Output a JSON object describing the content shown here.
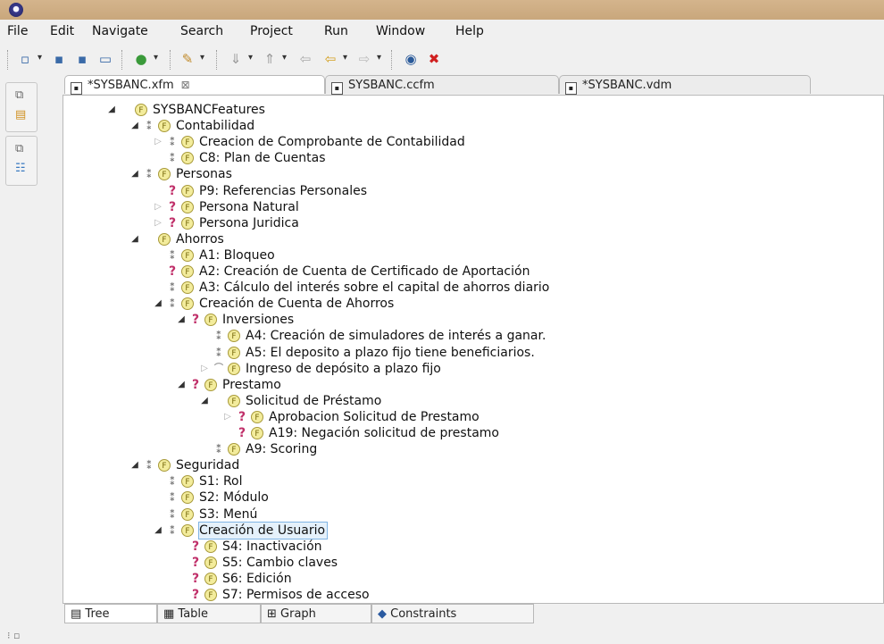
{
  "menubar": [
    "File",
    "Edit",
    "Navigate",
    "Search",
    "Project",
    "Run",
    "Window",
    "Help"
  ],
  "editor_tabs": [
    {
      "label": "*SYSBANC.xfm",
      "active": true,
      "close": "⊠"
    },
    {
      "label": "SYSBANC.ccfm",
      "active": false
    },
    {
      "label": "*SYSBANC.vdm",
      "active": false
    }
  ],
  "feature_badge": "F",
  "tree": [
    {
      "label": "SYSBANCFeatures",
      "toggle": "expanded",
      "constraint": "none"
    },
    {
      "label": "Contabilidad",
      "toggle": "expanded",
      "constraint": "mandatory"
    },
    {
      "label": "Creacion de Comprobante de Contabilidad",
      "toggle": "collapsed",
      "constraint": "mandatory"
    },
    {
      "label": "C8: Plan de Cuentas",
      "toggle": "none",
      "constraint": "mandatory"
    },
    {
      "label": "Personas",
      "toggle": "expanded",
      "constraint": "mandatory"
    },
    {
      "label": "P9: Referencias Personales",
      "toggle": "none",
      "constraint": "optional"
    },
    {
      "label": "Persona Natural",
      "toggle": "collapsed",
      "constraint": "optional"
    },
    {
      "label": "Persona Juridica",
      "toggle": "collapsed",
      "constraint": "optional"
    },
    {
      "label": "Ahorros",
      "toggle": "expanded",
      "constraint": "none"
    },
    {
      "label": "A1: Bloqueo",
      "toggle": "none",
      "constraint": "mandatory"
    },
    {
      "label": "A2:  Creación de Cuenta de Certificado de Aportación",
      "toggle": "none",
      "constraint": "optional"
    },
    {
      "label": "A3: Cálculo del interés sobre el capital de ahorros diario",
      "toggle": "none",
      "constraint": "mandatory"
    },
    {
      "label": "Creación de Cuenta de Ahorros",
      "toggle": "expanded",
      "constraint": "mandatory"
    },
    {
      "label": "Inversiones",
      "toggle": "expanded",
      "constraint": "optional"
    },
    {
      "label": "A4: Creación de simuladores de interés a ganar.",
      "toggle": "none",
      "constraint": "mandatory"
    },
    {
      "label": "A5: El deposito a plazo fijo tiene beneficiarios.",
      "toggle": "none",
      "constraint": "mandatory"
    },
    {
      "label": "Ingreso de depósito a plazo fijo",
      "toggle": "collapsed",
      "constraint": "alternative"
    },
    {
      "label": "Prestamo",
      "toggle": "expanded",
      "constraint": "optional"
    },
    {
      "label": "Solicitud de Préstamo",
      "toggle": "expanded",
      "constraint": "none"
    },
    {
      "label": "Aprobacion Solicitud de Prestamo",
      "toggle": "collapsed",
      "constraint": "optional"
    },
    {
      "label": "A19: Negación solicitud  de prestamo",
      "toggle": "none",
      "constraint": "optional"
    },
    {
      "label": "A9: Scoring",
      "toggle": "none",
      "constraint": "mandatory"
    },
    {
      "label": "Seguridad",
      "toggle": "expanded",
      "constraint": "mandatory"
    },
    {
      "label": "S1: Rol",
      "toggle": "none",
      "constraint": "mandatory"
    },
    {
      "label": "S2: Módulo",
      "toggle": "none",
      "constraint": "mandatory"
    },
    {
      "label": "S3: Menú",
      "toggle": "none",
      "constraint": "mandatory"
    },
    {
      "label": "Creación de Usuario",
      "toggle": "expanded",
      "constraint": "mandatory",
      "selected": true
    },
    {
      "label": "S4: Inactivación",
      "toggle": "none",
      "constraint": "optional"
    },
    {
      "label": "S5: Cambio claves",
      "toggle": "none",
      "constraint": "optional"
    },
    {
      "label": "S6: Edición",
      "toggle": "none",
      "constraint": "optional"
    },
    {
      "label": "S7: Permisos de acceso",
      "toggle": "none",
      "constraint": "optional"
    }
  ],
  "bottom_tabs": [
    {
      "label": "Tree",
      "active": true
    },
    {
      "label": "Table",
      "active": false
    },
    {
      "label": "Graph",
      "active": false
    },
    {
      "label": "Constraints",
      "active": false
    }
  ]
}
